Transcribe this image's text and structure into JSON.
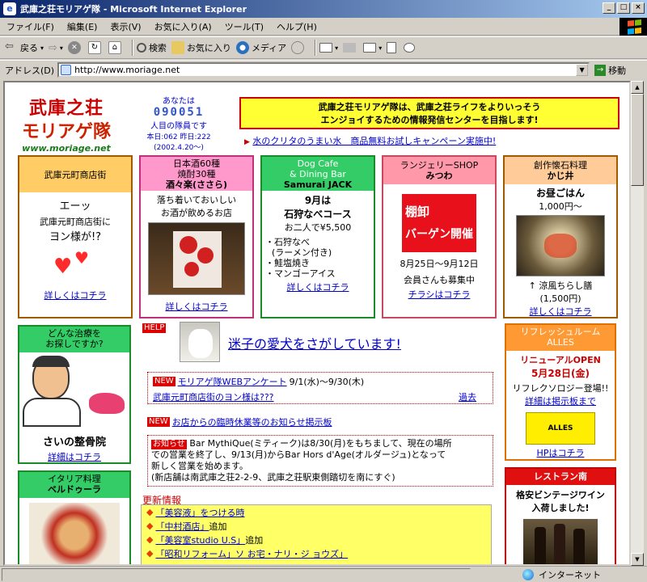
{
  "window": {
    "title": "武庫之荘モリアゲ隊 - Microsoft Internet Explorer",
    "buttons": [
      "_",
      "□",
      "×"
    ]
  },
  "menu": [
    "ファイル(F)",
    "編集(E)",
    "表示(V)",
    "お気に入り(A)",
    "ツール(T)",
    "ヘルプ(H)"
  ],
  "toolbar": {
    "back": "戻る",
    "search": "検索",
    "favorites": "お気に入り",
    "media": "メディア"
  },
  "address": {
    "label": "アドレス(D)",
    "url": "http://www.moriage.net",
    "go": "移動"
  },
  "status": {
    "zone": "インターネット"
  },
  "page": {
    "logo": {
      "line1": "武庫之荘",
      "line2": "モリアゲ隊",
      "url": "www.moriage.net"
    },
    "counter": {
      "you_are": "あなたは",
      "number": "090051",
      "visitor": "人目の隊員です",
      "today_label": "本日:",
      "today": "062",
      "yesterday_label": "昨日:",
      "yesterday": "222",
      "since": "(2002.4.20〜)"
    },
    "banner": {
      "line1": "武庫之荘モリアゲ隊は、武庫之荘ライフをよりいっそう",
      "line2": "エンジョイするための情報発信センターを目指します!"
    },
    "campaign": "水のクリタのうまい水　商品無料お試しキャンペーン実施中!",
    "cards": [
      {
        "head": "武庫元町商店街",
        "line1": "エーッ",
        "line2": "武庫元町商店街に",
        "line3": "ヨン様が!?",
        "link": "詳しくはコチラ"
      },
      {
        "head1": "日本酒60種",
        "head2": "焼酎30種",
        "head3": "酒々楽(ささら)",
        "line1": "落ち着いておいしい",
        "line2": "お酒が飲めるお店",
        "link": "詳しくはコチラ"
      },
      {
        "head1": "Dog Cafe",
        "head2": "& Dining Bar",
        "head3": "Samurai JACK",
        "line1": "9月は",
        "line2": "石狩なべコース",
        "line3": "お二人で¥5,500",
        "items": [
          "・石狩なべ",
          "(ラーメン付き)",
          "・鮭塩焼き",
          "・マンゴーアイス"
        ],
        "link": "詳しくはコチラ"
      },
      {
        "head1": "ランジェリーSHOP",
        "head2": "みつわ",
        "sale1": "棚卸",
        "sale2": "バーゲン開催",
        "line1": "8月25日〜9月12日",
        "line2": "会員さんも募集中",
        "link": "チラシはコチラ"
      },
      {
        "head1": "創作懐石料理",
        "head2": "かじ井",
        "line1": "お昼ごはん",
        "line2": "1,000円〜",
        "line3": "↑ 涼風ちらし膳",
        "line4": "(1,500円)",
        "link": "詳しくはコチラ"
      }
    ],
    "left": {
      "seikotsu_head1": "どんな治療を",
      "seikotsu_head2": "お探しですか?",
      "seikotsu_name": "さいの整骨院",
      "seikotsu_link": "詳細はコチラ",
      "italy_head1": "イタリア料理",
      "italy_head2": "ベルドゥーラ"
    },
    "center": {
      "help_badge": "HELP",
      "lost_dog": "迷子の愛犬をさがしています!",
      "new_badge": "NEW",
      "survey": "モリアゲ隊WEBアンケート",
      "survey_date": "9/1(水)〜9/30(木)",
      "survey2": "武庫元町商店街のヨン様は???",
      "past": "過去",
      "notice": "お店からの臨時休業等のお知らせ掲示板",
      "oshirase_badge": "お知らせ",
      "oshirase1": "Bar MythiQue(ミティーク)は8/30(月)をもちまして、現在の場所",
      "oshirase2": "での営業を終了し、9/13(月)からBar Hors d'Age(オルダージュ)となって",
      "oshirase3": "新しく営業を始めます。",
      "oshirase4": "(新店舗は南武庫之荘2-2-9、武庫之荘駅東側踏切を南にすぐ)",
      "update_title": "更新情報",
      "updates": [
        {
          "link": "「美容液」をつける時",
          "rest": ""
        },
        {
          "link": "「中村酒店」",
          "rest": "追加"
        },
        {
          "link": "「美容室studio U.S」",
          "rest": "追加"
        },
        {
          "link": "「昭和リフォーム」ソ お宅・ナリ・ジ ョウズ」",
          "rest": ""
        }
      ]
    },
    "right": {
      "alles_head1": "リフレッシュルーム",
      "alles_head2": "ALLES",
      "alles_open": "リニューアルOPEN",
      "alles_date": "5月28日(金)",
      "alles_line": "リフレクソロジー登場!!",
      "alles_link": "詳細は掲示板まで",
      "alles_logo": "ALLES",
      "alles_hp": "HPはコチラ",
      "rest_head": "レストラン南",
      "rest_line1": "格安ビンテージワイン",
      "rest_line2": "入荷しました!"
    }
  }
}
